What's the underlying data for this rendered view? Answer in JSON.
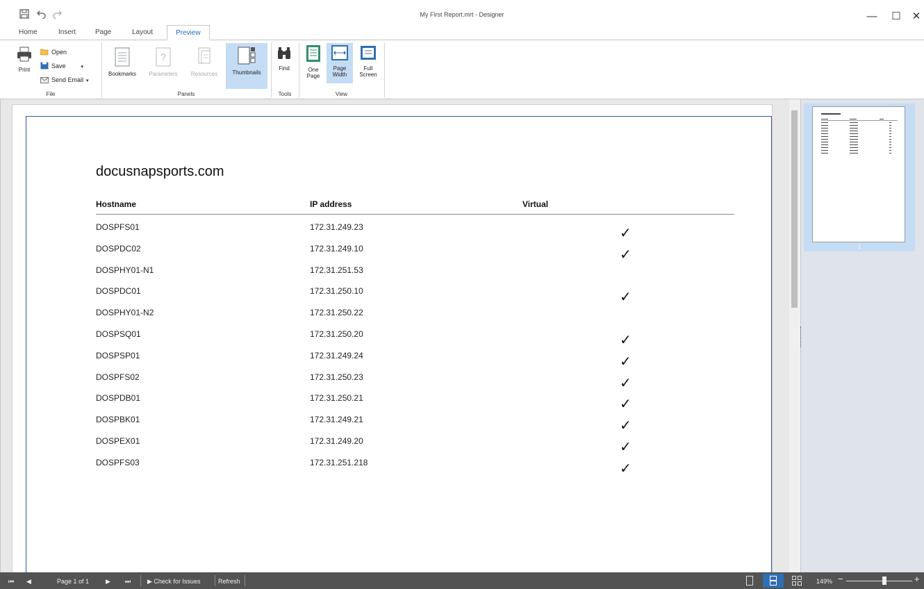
{
  "window": {
    "title": "My First Report.mrt - Designer",
    "minimize_glyph": "—",
    "maximize_glyph": "☐",
    "close_glyph": "✕"
  },
  "qat": {
    "save_icon": "save-icon",
    "undo_icon": "undo-icon",
    "redo_icon": "redo-icon"
  },
  "tabs": [
    {
      "label": "Home"
    },
    {
      "label": "Insert"
    },
    {
      "label": "Page"
    },
    {
      "label": "Layout"
    },
    {
      "label": "Preview",
      "active": true
    }
  ],
  "ribbon": {
    "file": {
      "label": "File",
      "print": "Print",
      "open": "Open",
      "save": "Save",
      "send_email": "Send Email"
    },
    "panels": {
      "label": "Panels",
      "bookmarks": "Bookmarks",
      "parameters": "Parameters",
      "resources": "Resources",
      "thumbnails": "Thumbnails"
    },
    "tools": {
      "label": "Tools",
      "find": "Find"
    },
    "view": {
      "label": "View",
      "one_page_1": "One",
      "one_page_2": "Page",
      "page_width_1": "Page",
      "page_width_2": "Width",
      "full_screen_1": "Full",
      "full_screen_2": "Screen"
    }
  },
  "report": {
    "title": "docusnapsports.com",
    "columns": [
      "Hostname",
      "IP address",
      "Virtual"
    ],
    "rows": [
      {
        "hostname": "DOSPFS01",
        "ip": "172.31.249.23",
        "virtual": true
      },
      {
        "hostname": "DOSPDC02",
        "ip": "172.31.249.10",
        "virtual": true
      },
      {
        "hostname": "DOSPHY01-N1",
        "ip": "172.31.251.53",
        "virtual": false
      },
      {
        "hostname": "DOSPDC01",
        "ip": "172.31.250.10",
        "virtual": true
      },
      {
        "hostname": "DOSPHY01-N2",
        "ip": "172.31.250.22",
        "virtual": false
      },
      {
        "hostname": "DOSPSQ01",
        "ip": "172.31.250.20",
        "virtual": true
      },
      {
        "hostname": "DOSPSP01",
        "ip": "172.31.249.24",
        "virtual": true
      },
      {
        "hostname": "DOSPFS02",
        "ip": "172.31.250.23",
        "virtual": true
      },
      {
        "hostname": "DOSPDB01",
        "ip": "172.31.250.21",
        "virtual": true
      },
      {
        "hostname": "DOSPBK01",
        "ip": "172.31.249.21",
        "virtual": true
      },
      {
        "hostname": "DOSPEX01",
        "ip": "172.31.249.20",
        "virtual": true
      },
      {
        "hostname": "DOSPFS03",
        "ip": "172.31.251.218",
        "virtual": true
      }
    ],
    "check_glyph": "✓"
  },
  "thumbnails": {
    "page_number": "1"
  },
  "statusbar": {
    "page_info": "Page 1 of 1",
    "check_for_issues": "Check for Issues",
    "refresh": "Refresh",
    "zoom": "149%",
    "zoom_out": "−",
    "zoom_in": "+"
  },
  "colors": {
    "accent": "#1f6bb8",
    "margin_border": "#2b5797",
    "selected": "#c5dcf5",
    "statusbar": "#535353"
  }
}
